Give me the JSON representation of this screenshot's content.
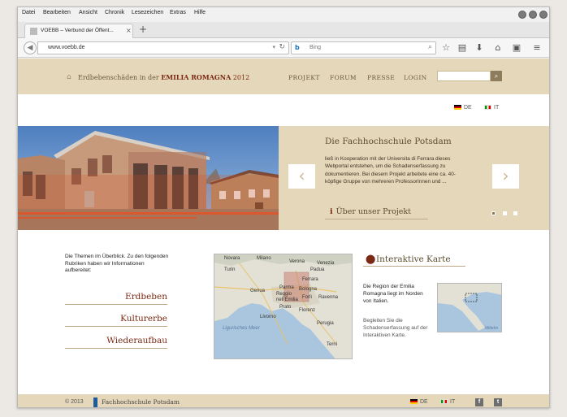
{
  "menubar": {
    "items": [
      "Datei",
      "Bearbeiten",
      "Ansicht",
      "Chronik",
      "Lesezeichen",
      "Extras",
      "Hilfe"
    ]
  },
  "tab": {
    "title": "VOEBB – Verbund der Öffent...",
    "close": "×",
    "new_tab": "+"
  },
  "navbar": {
    "url": "www.voebb.de",
    "search_engine": "Bing",
    "search_placeholder": "Bing"
  },
  "site": {
    "title_prefix": "Erdbebenschäden in der",
    "title_region": "EMILIA ROMAGNA",
    "title_year": "2012",
    "nav": [
      "PROJEKT",
      "FORUM",
      "PRESSE",
      "LOGIN"
    ],
    "lang": {
      "de": "DE",
      "it": "IT"
    }
  },
  "hero": {
    "heading": "Die Fachhochschule Potsdam",
    "text": "ließ in Kooperation mit der Universita di Ferrara dieses Webportal entstehen, um die Schadenserfassung zu dokumentieren. Bei diesem Projekt arbeitete eine ca. 40-köpfige Gruppe von mehreren ProfessorInnen und ...",
    "link": "Über unser Projekt",
    "prev": "‹",
    "next": "›",
    "slides": [
      true,
      false,
      false
    ]
  },
  "themes": {
    "intro": "Die Themen im Überblick. Zu den folgenden Rubriken haben wir Informationen aufbereitet:",
    "links": [
      "Erdbeben",
      "Kulturerbe",
      "Wiederaufbau"
    ]
  },
  "map": {
    "labels": [
      "Novara",
      "Milano",
      "Verona",
      "Venezia",
      "Turin",
      "Padua",
      "Parma",
      "Ferrara",
      "Genua",
      "Bologna",
      "Reggio nell'Emilia",
      "Forlì",
      "Ravenna",
      "Livorno",
      "Prato",
      "Florenz",
      "Ligurisches Meer",
      "Perugia",
      "Terni"
    ]
  },
  "interactive": {
    "title": "Interaktive Karte",
    "text": "Die Region der Emilia Romagna liegt im Norden von Italien.",
    "text2": "Begleiten Sie die Schadenserfassung auf der Interaktiven Karte.",
    "mini_label": "Mittelm"
  },
  "footer": {
    "copyright": "© 2013",
    "org": "Fachhochschule Potsdam",
    "lang_de": "DE",
    "lang_it": "IT",
    "facebook": "f",
    "twitter": "t"
  },
  "colors": {
    "header_bg": "#e5d7b9",
    "accent": "#7a2a14"
  }
}
